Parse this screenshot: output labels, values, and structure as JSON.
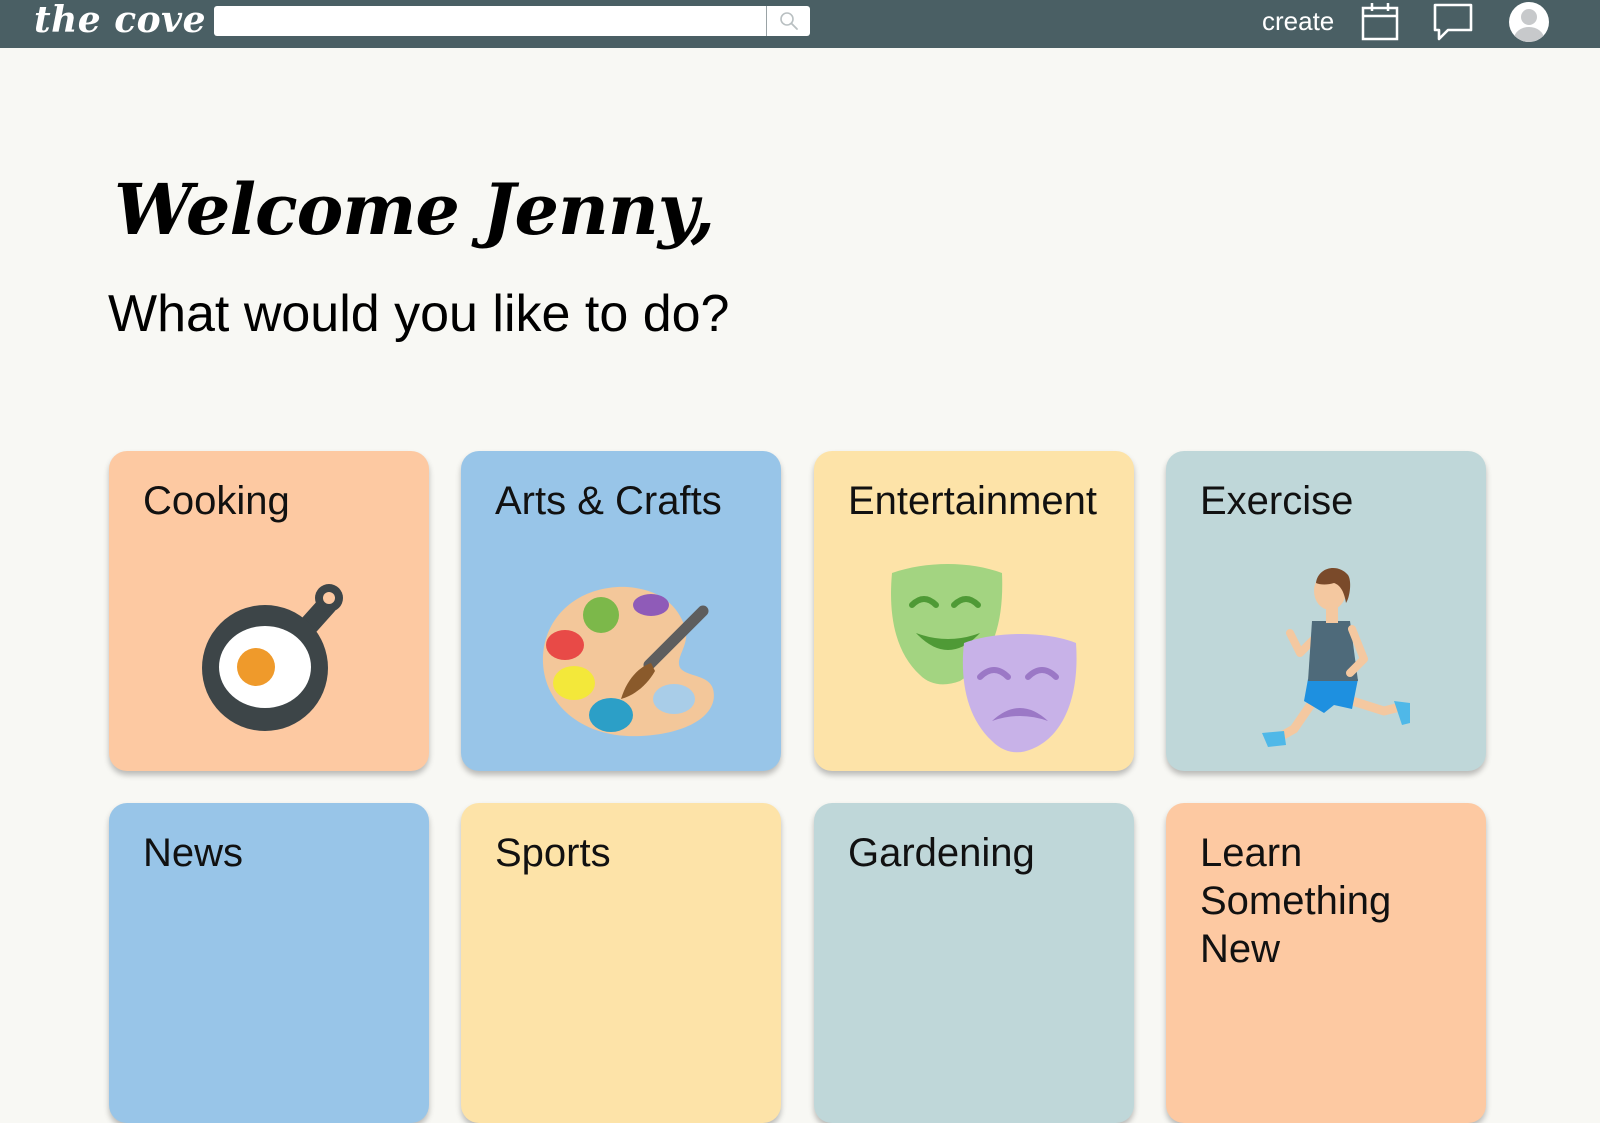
{
  "header": {
    "logo": "the cove",
    "search_placeholder": "",
    "create_label": "create"
  },
  "welcome": {
    "greeting": "Welcome Jenny,",
    "prompt": "What would you like to do?"
  },
  "categories": [
    {
      "label": "Cooking",
      "color": "#fdc9a2",
      "icon": "frying-pan-egg-icon"
    },
    {
      "label": "Arts & Crafts",
      "color": "#98c5e8",
      "icon": "paint-palette-icon"
    },
    {
      "label": "Entertainment",
      "color": "#fde3a8",
      "icon": "theater-masks-icon"
    },
    {
      "label": "Exercise",
      "color": "#bfd7d9",
      "icon": "running-person-icon"
    },
    {
      "label": "News",
      "color": "#98c5e8",
      "icon": ""
    },
    {
      "label": "Sports",
      "color": "#fde3a8",
      "icon": ""
    },
    {
      "label": "Gardening",
      "color": "#bfd7d9",
      "icon": ""
    },
    {
      "label": "Learn Something New",
      "color": "#fdc9a2",
      "icon": ""
    }
  ],
  "colors": {
    "topbar": "#4a5f64",
    "background": "#f8f8f4"
  }
}
